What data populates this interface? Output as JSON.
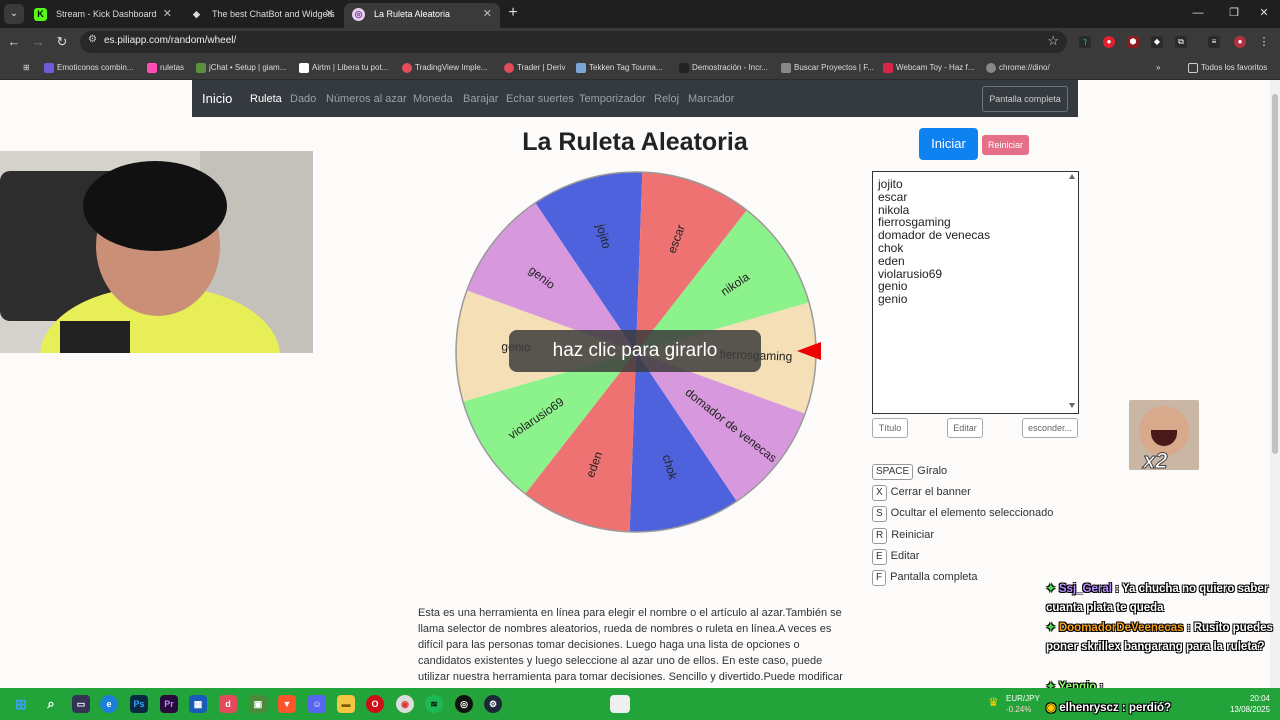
{
  "browser": {
    "tabs": [
      {
        "title": "Stream - Kick Dashboard",
        "icon": "kick-icon",
        "color": "#53fc18",
        "glyph": "K",
        "active": false
      },
      {
        "title": "The best ChatBot and Widgets",
        "icon": "botrix-icon",
        "color": "#dddddd",
        "glyph": "◆",
        "active": false
      },
      {
        "title": "La Ruleta Aleatoria",
        "icon": "wheel-favicon",
        "color": "#e8d0f0",
        "glyph": "◎",
        "active": true
      }
    ],
    "url": "es.piliapp.com/random/wheel/",
    "bookmarks": [
      {
        "label": "Emoticonos combin...",
        "color": "#6f5bd8"
      },
      {
        "label": "ruletas",
        "color": "#ff4bb4"
      },
      {
        "label": "jChat • Setup | giam...",
        "color": "#5b8f3b"
      },
      {
        "label": "Airtm | Libera tu pot...",
        "color": "#ffffff"
      },
      {
        "label": "TradingView Imple...",
        "color": "#e34d5b"
      },
      {
        "label": "Trader | Deriv",
        "color": "#e34d5b"
      },
      {
        "label": "Tekken Tag Tourna...",
        "color": "#7aa7d9"
      },
      {
        "label": "Demostración - Incr...",
        "color": "#222222"
      },
      {
        "label": "Buscar Proyectos | F...",
        "color": "#888888"
      },
      {
        "label": "Webcam Toy - Haz f...",
        "color": "#d8264a"
      },
      {
        "label": "chrome://dino/",
        "color": "#888888"
      }
    ],
    "all_bookmarks": "Todos los favoritos"
  },
  "site": {
    "brand": "Inicio",
    "nav": [
      "Ruleta",
      "Dado",
      "Números al azar",
      "Moneda",
      "Barajar",
      "Echar suertes",
      "Temporizador",
      "Reloj",
      "Marcador"
    ],
    "active_nav": "Ruleta",
    "fullscreen": "Pantalla completa"
  },
  "wheel": {
    "title": "La Ruleta Aleatoria",
    "spin_label": "haz clic para girarlo",
    "segments": [
      {
        "label": "fierrosgaming",
        "color": "#f4dfb6"
      },
      {
        "label": "domador de venecas",
        "color": "#d898dd"
      },
      {
        "label": "chok",
        "color": "#4d62dc"
      },
      {
        "label": "eden",
        "color": "#ee7272"
      },
      {
        "label": "violarusio69",
        "color": "#8cf28c"
      },
      {
        "label": "genio",
        "color": "#f4dfb6"
      },
      {
        "label": "genio",
        "color": "#d898dd"
      },
      {
        "label": "jojito",
        "color": "#4d62dc"
      },
      {
        "label": "escar",
        "color": "#ee7272"
      },
      {
        "label": "nikola",
        "color": "#8cf28c"
      }
    ]
  },
  "controls": {
    "start": "Iniciar",
    "reset": "Reiniciar",
    "names": "jojito\nescar\nnikola\nfierrosgaming\ndomador de venecas\nchok\neden\nviolarusio69\ngenio\ngenio",
    "title_btn": "Título",
    "edit_btn": "Editar",
    "hide_btn": "esconder..."
  },
  "shortcuts": [
    {
      "key": "SPACE",
      "label": "Gíralo"
    },
    {
      "key": "X",
      "label": "Cerrar el banner"
    },
    {
      "key": "S",
      "label": "Ocultar el elemento seleccionado"
    },
    {
      "key": "R",
      "label": "Reiniciar"
    },
    {
      "key": "E",
      "label": "Editar"
    },
    {
      "key": "F",
      "label": "Pantalla completa"
    }
  ],
  "description": "Esta es una herramienta en línea para elegir el nombre o el artículo al azar.También se llama selector de nombres aleatorios, rueda de nombres o ruleta en línea.A veces es difícil para las personas tomar decisiones. Luego haga una lista de opciones o candidatos existentes y luego seleccione al azar uno de ellos. En este caso, puede utilizar nuestra herramienta para tomar decisiones. Sencillo y divertido.Puede modificar los nombres en textarea, poner un",
  "overlay": {
    "emote_text": "x2",
    "chat": [
      {
        "user": "Ssj_Geral",
        "msg": ": Ya chucha no quiero saber cuanta plata te queda"
      },
      {
        "user": "DoomadorDeVeenecas",
        "msg": ": Rusito puedes poner skrillex bangarang para la ruleta?"
      },
      {
        "user": "Yengio",
        "msg": ":"
      },
      {
        "user": "elhenryscz",
        "msg": ": perdió?"
      }
    ]
  },
  "taskbar": {
    "ticker": "EUR/JPY",
    "change": "-0.24%",
    "time": "20:04",
    "date": "13/08/2025"
  }
}
